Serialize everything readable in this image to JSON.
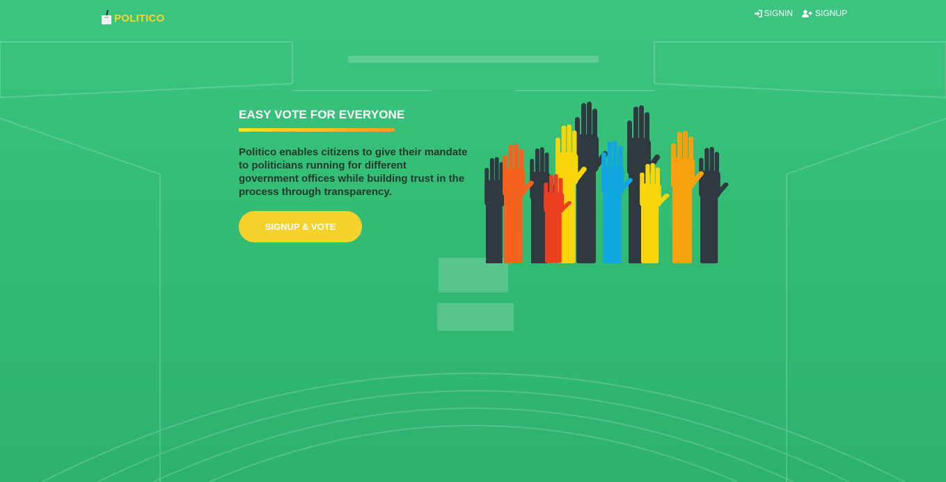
{
  "app": {
    "brand": "POLITICO",
    "brand_icon": "ballot-box-icon"
  },
  "nav": {
    "signin_label": "SIGNIN",
    "signin_icon": "sign-in-icon",
    "signup_label": "SIGNUP",
    "signup_icon": "user-plus-icon"
  },
  "hero": {
    "title": "EASY VOTE FOR EVERYONE",
    "description": "Politico enables citizens to give their mandate to politicians running for different government offices while building trust in the process through transparency.",
    "cta_label": "SIGNUP & VOTE",
    "illustration": "raised-hands-illustration"
  },
  "colors": {
    "background": "#35bd76",
    "accent": "#f5d22a",
    "brand": "#f8d529",
    "hand_dark": "#2e3a3f",
    "hand_orange": "#f5621f",
    "hand_yellow": "#f9d60c",
    "hand_red": "#ee3e22",
    "hand_blue": "#11a7e0",
    "hand_amber": "#f7a10e"
  }
}
